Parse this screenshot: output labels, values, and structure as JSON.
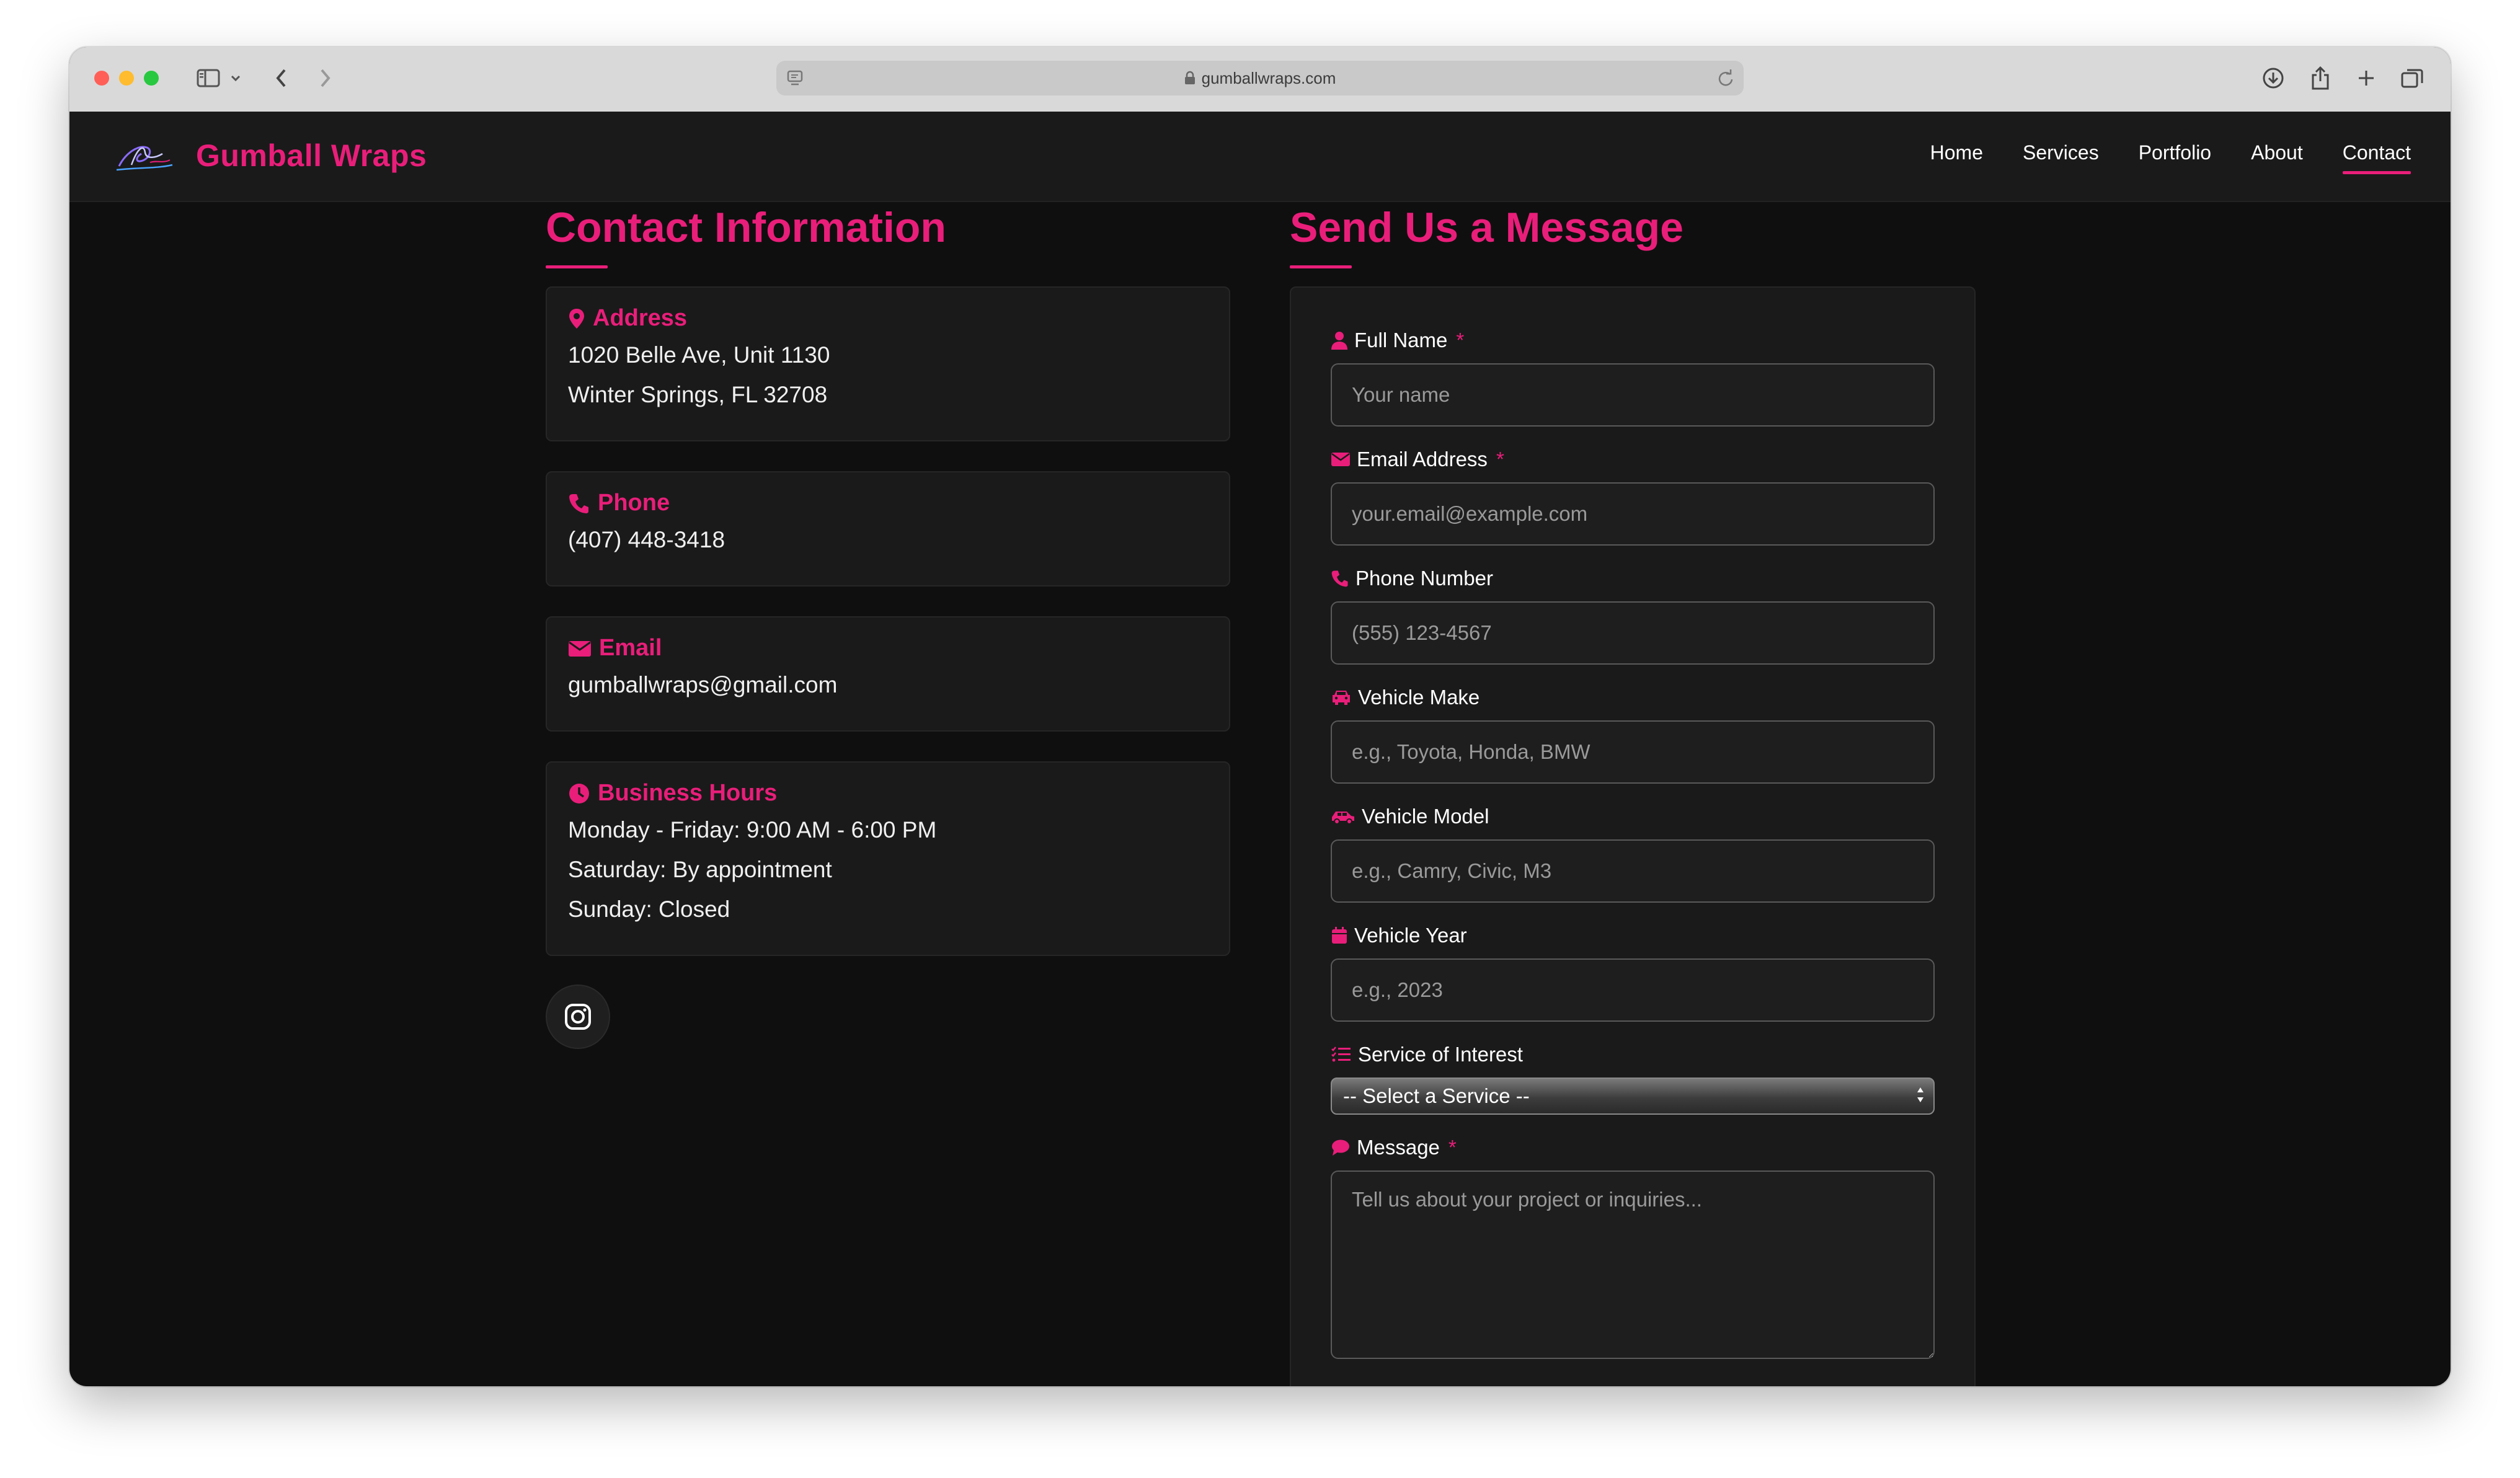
{
  "browser": {
    "url": "gumballwraps.com"
  },
  "site": {
    "brand": "Gumball Wraps",
    "nav": [
      {
        "label": "Home"
      },
      {
        "label": "Services"
      },
      {
        "label": "Portfolio"
      },
      {
        "label": "About"
      },
      {
        "label": "Contact",
        "active": true
      }
    ]
  },
  "contact": {
    "heading": "Contact Information",
    "address": {
      "title": "Address",
      "line1": "1020 Belle Ave, Unit 1130",
      "line2": "Winter Springs, FL 32708"
    },
    "phone": {
      "title": "Phone",
      "value": "(407) 448-3418"
    },
    "email": {
      "title": "Email",
      "value": "gumballwraps@gmail.com"
    },
    "hours": {
      "title": "Business Hours",
      "weekdays": "Monday - Friday: 9:00 AM - 6:00 PM",
      "saturday": "Saturday: By appointment",
      "sunday": "Sunday: Closed"
    }
  },
  "form": {
    "heading": "Send Us a Message",
    "required_mark": "*",
    "full_name": {
      "label": "Full Name",
      "placeholder": "Your name"
    },
    "email": {
      "label": "Email Address",
      "placeholder": "your.email@example.com"
    },
    "phone": {
      "label": "Phone Number",
      "placeholder": "(555) 123-4567"
    },
    "make": {
      "label": "Vehicle Make",
      "placeholder": "e.g., Toyota, Honda, BMW"
    },
    "model": {
      "label": "Vehicle Model",
      "placeholder": "e.g., Camry, Civic, M3"
    },
    "year": {
      "label": "Vehicle Year",
      "placeholder": "e.g., 2023"
    },
    "service": {
      "label": "Service of Interest",
      "selected": "-- Select a Service --"
    },
    "message": {
      "label": "Message",
      "placeholder": "Tell us about your project or inquiries..."
    }
  },
  "colors": {
    "accent": "#e91e7a",
    "background": "#0f0f0f",
    "card": "#1a1a1a"
  }
}
